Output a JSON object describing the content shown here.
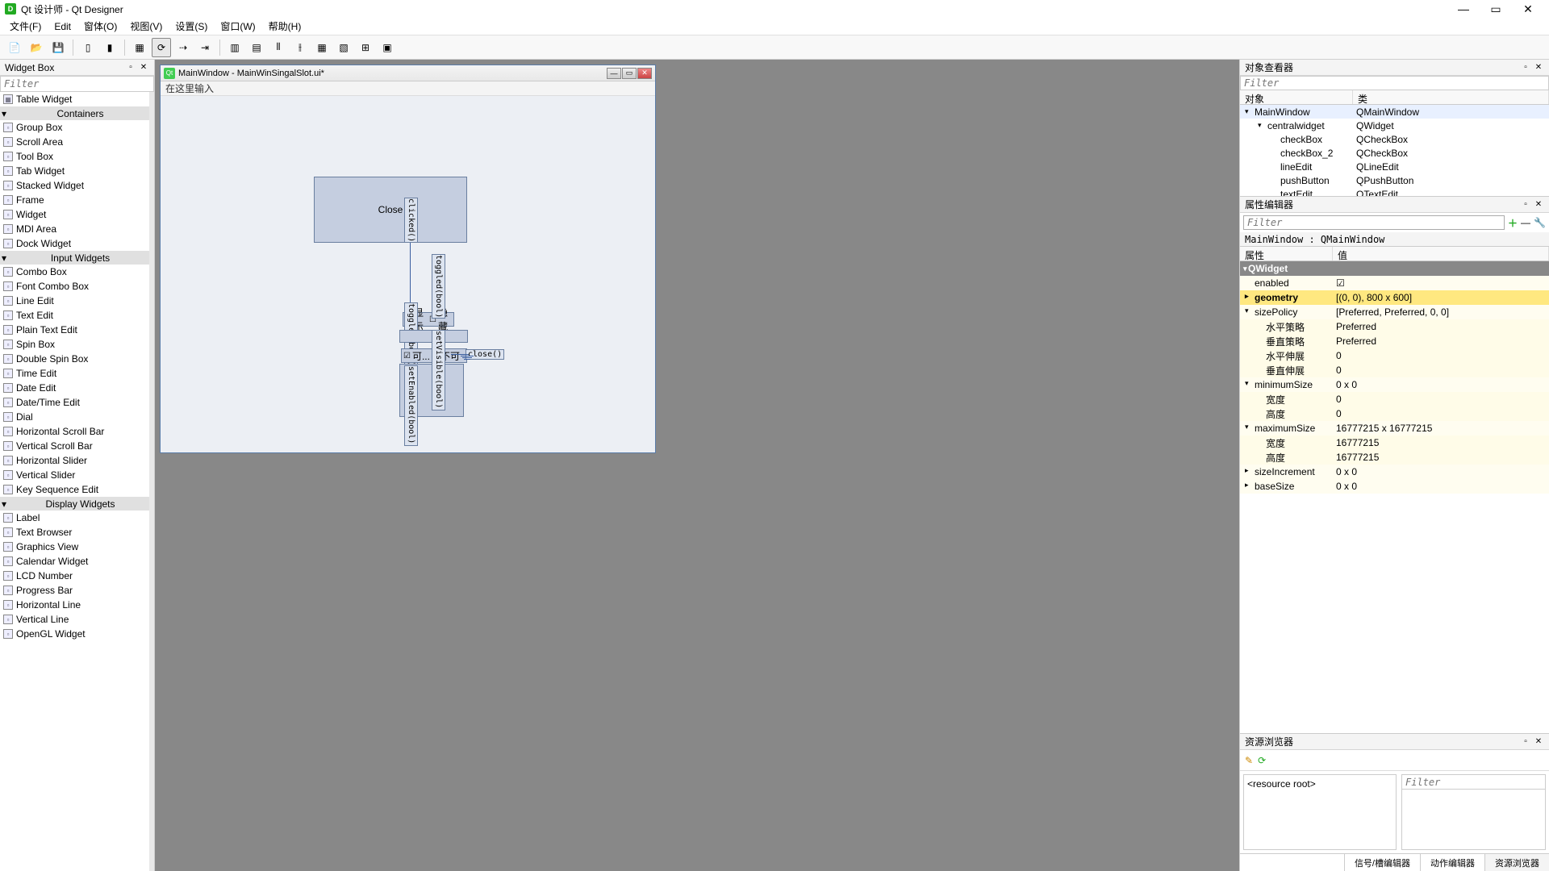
{
  "app": {
    "title": "Qt 设计师 - Qt Designer"
  },
  "menu": [
    "文件(F)",
    "Edit",
    "窗体(O)",
    "视图(V)",
    "设置(S)",
    "窗口(W)",
    "帮助(H)"
  ],
  "widgetbox": {
    "title": "Widget Box",
    "filter": "Filter",
    "top_item": "Table Widget",
    "cats": [
      {
        "name": "Containers",
        "items": [
          "Group Box",
          "Scroll Area",
          "Tool Box",
          "Tab Widget",
          "Stacked Widget",
          "Frame",
          "Widget",
          "MDI Area",
          "Dock Widget"
        ]
      },
      {
        "name": "Input Widgets",
        "items": [
          "Combo Box",
          "Font Combo Box",
          "Line Edit",
          "Text Edit",
          "Plain Text Edit",
          "Spin Box",
          "Double Spin Box",
          "Time Edit",
          "Date Edit",
          "Date/Time Edit",
          "Dial",
          "Horizontal Scroll Bar",
          "Vertical Scroll Bar",
          "Horizontal Slider",
          "Vertical Slider",
          "Key Sequence Edit"
        ]
      },
      {
        "name": "Display Widgets",
        "items": [
          "Label",
          "Text Browser",
          "Graphics View",
          "Calendar Widget",
          "LCD Number",
          "Progress Bar",
          "Horizontal Line",
          "Vertical Line",
          "OpenGL Widget"
        ]
      }
    ]
  },
  "form": {
    "title": "MainWindow - MainWinSingalSlot.ui*",
    "menubar_hint": "在这里输入",
    "close_btn": "Close",
    "sig_clicked": "clicked()",
    "sig_toggled": "toggled(bool)",
    "sig_toggled2": "toggled(bool)",
    "slot_setEnabled": "setEnabled(bool)",
    "slot_setVisible": "setVisible(bool)",
    "slot_close": "close()",
    "chk_show": "显示",
    "chk_hide": "隐藏",
    "chk_ke": "可...",
    "chk_buke": "不可"
  },
  "objinsp": {
    "title": "对象查看器",
    "filter": "Filter",
    "h1": "对象",
    "h2": "类",
    "rows": [
      {
        "indent": 0,
        "exp": "▾",
        "name": "MainWindow",
        "cls": "QMainWindow",
        "sel": true
      },
      {
        "indent": 1,
        "exp": "▾",
        "name": "centralwidget",
        "cls": "QWidget"
      },
      {
        "indent": 2,
        "exp": "",
        "name": "checkBox",
        "cls": "QCheckBox"
      },
      {
        "indent": 2,
        "exp": "",
        "name": "checkBox_2",
        "cls": "QCheckBox"
      },
      {
        "indent": 2,
        "exp": "",
        "name": "lineEdit",
        "cls": "QLineEdit"
      },
      {
        "indent": 2,
        "exp": "",
        "name": "pushButton",
        "cls": "QPushButton"
      },
      {
        "indent": 2,
        "exp": "",
        "name": "textEdit",
        "cls": "QTextEdit"
      }
    ]
  },
  "propedit": {
    "title": "属性编辑器",
    "filter": "Filter",
    "head": "MainWindow : QMainWindow",
    "h1": "属性",
    "h2": "值",
    "group": "QWidget",
    "rows": [
      {
        "exp": "",
        "name": "enabled",
        "val": "☑",
        "c": "yel"
      },
      {
        "exp": "▸",
        "name": "geometry",
        "val": "[(0, 0), 800 x 600]",
        "c": "hl",
        "bold": true
      },
      {
        "exp": "▾",
        "name": "sizePolicy",
        "val": "[Preferred, Preferred, 0, 0]",
        "c": "yel"
      },
      {
        "exp": "",
        "name": "水平策略",
        "val": "Preferred",
        "c": "yel2",
        "indent": 1
      },
      {
        "exp": "",
        "name": "垂直策略",
        "val": "Preferred",
        "c": "yel2",
        "indent": 1
      },
      {
        "exp": "",
        "name": "水平伸展",
        "val": "0",
        "c": "yel2",
        "indent": 1
      },
      {
        "exp": "",
        "name": "垂直伸展",
        "val": "0",
        "c": "yel2",
        "indent": 1
      },
      {
        "exp": "▾",
        "name": "minimumSize",
        "val": "0 x 0",
        "c": "yel"
      },
      {
        "exp": "",
        "name": "宽度",
        "val": "0",
        "c": "yel2",
        "indent": 1
      },
      {
        "exp": "",
        "name": "高度",
        "val": "0",
        "c": "yel2",
        "indent": 1
      },
      {
        "exp": "▾",
        "name": "maximumSize",
        "val": "16777215 x 16777215",
        "c": "yel"
      },
      {
        "exp": "",
        "name": "宽度",
        "val": "16777215",
        "c": "yel2",
        "indent": 1
      },
      {
        "exp": "",
        "name": "高度",
        "val": "16777215",
        "c": "yel2",
        "indent": 1
      },
      {
        "exp": "▸",
        "name": "sizeIncrement",
        "val": "0 x 0",
        "c": "yel"
      },
      {
        "exp": "▸",
        "name": "baseSize",
        "val": "0 x 0",
        "c": "yel"
      }
    ]
  },
  "resbrowser": {
    "title": "资源浏览器",
    "filter": "Filter",
    "root": "<resource root>",
    "tabs": [
      "信号/槽编辑器",
      "动作编辑器",
      "资源浏览器"
    ]
  }
}
